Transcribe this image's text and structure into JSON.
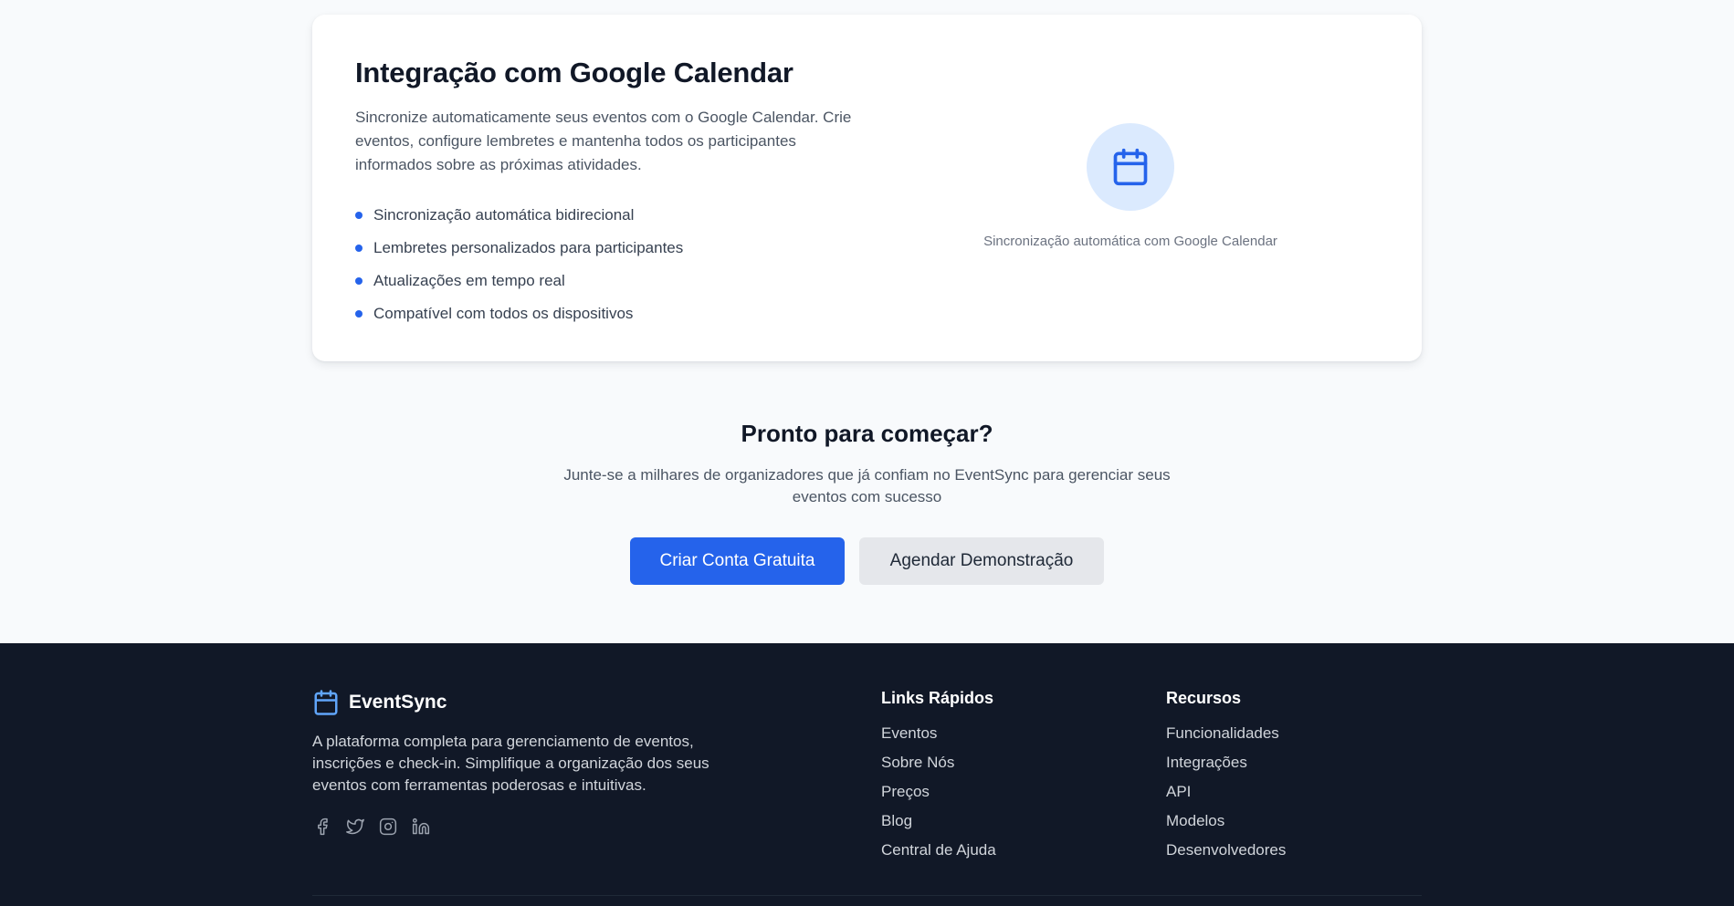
{
  "integration": {
    "title": "Integração com Google Calendar",
    "description": "Sincronize automaticamente seus eventos com o Google Calendar. Crie eventos, configure lembretes e mantenha todos os participantes informados sobre as próximas atividades.",
    "features": [
      "Sincronização automática bidirecional",
      "Lembretes personalizados para participantes",
      "Atualizações em tempo real",
      "Compatível com todos os dispositivos"
    ],
    "icon": "calendar-icon",
    "caption": "Sincronização automática com Google Calendar"
  },
  "cta": {
    "title": "Pronto para começar?",
    "subtitle": "Junte-se a milhares de organizadores que já confiam no EventSync para gerenciar seus eventos com sucesso",
    "primary_label": "Criar Conta Gratuita",
    "secondary_label": "Agendar Demonstração"
  },
  "footer": {
    "brand": "EventSync",
    "brand_icon": "calendar-icon",
    "description": "A plataforma completa para gerenciamento de eventos, inscrições e check-in. Simplifique a organização dos seus eventos com ferramentas poderosas e intuitivas.",
    "socials": [
      "facebook-icon",
      "twitter-icon",
      "instagram-icon",
      "linkedin-icon"
    ],
    "quick_links": {
      "title": "Links Rápidos",
      "items": [
        "Eventos",
        "Sobre Nós",
        "Preços",
        "Blog",
        "Central de Ajuda"
      ]
    },
    "resources": {
      "title": "Recursos",
      "items": [
        "Funcionalidades",
        "Integrações",
        "API",
        "Modelos",
        "Desenvolvedores"
      ]
    }
  },
  "colors": {
    "accent": "#2563eb",
    "footer_bg": "#111827",
    "page_bg": "#f8fafc"
  }
}
